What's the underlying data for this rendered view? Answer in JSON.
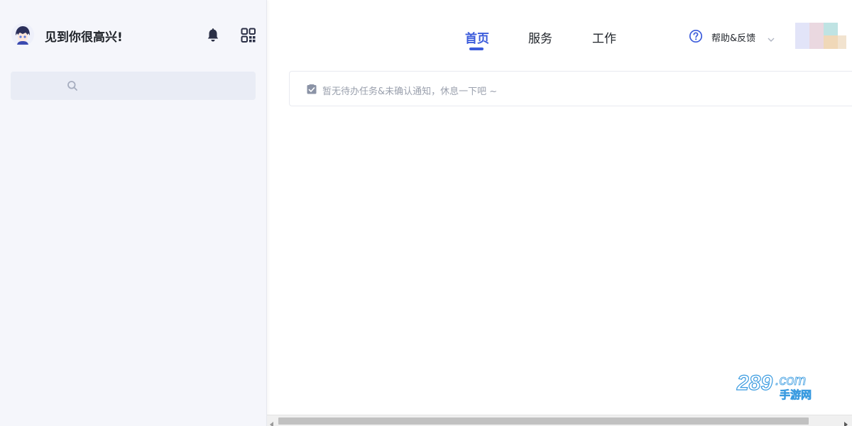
{
  "sidebar": {
    "greeting": "见到你很高兴!",
    "search": {
      "value": "",
      "placeholder": ""
    }
  },
  "nav": {
    "tabs": [
      {
        "label": "首页",
        "active": true
      },
      {
        "label": "服务",
        "active": false
      },
      {
        "label": "工作",
        "active": false
      }
    ],
    "help_label": "帮助&反馈"
  },
  "notice": {
    "text": "暂无待办任务&未确认通知，休息一下吧 ~"
  },
  "watermark": {
    "brand_text": "289.com",
    "sub_text": "手游网"
  },
  "colors": {
    "accent": "#3b5bdb",
    "sidebar_bg": "#f5f6fb",
    "search_bg": "#e9ecf5",
    "notice_text": "#9aa0ad"
  },
  "icons": {
    "bell": "bell-icon",
    "qr": "qr-code-icon",
    "search": "search-icon",
    "help": "help-circle-icon",
    "chevron": "chevron-down-icon",
    "notice": "checkbox-icon"
  }
}
